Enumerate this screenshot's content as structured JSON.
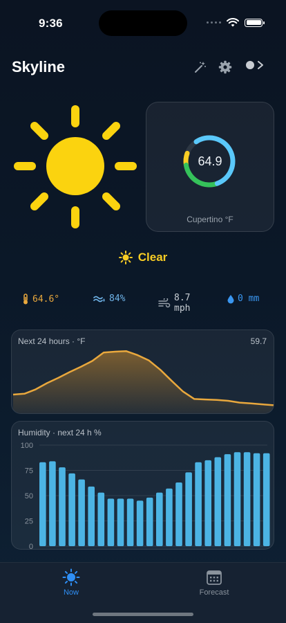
{
  "status_bar": {
    "time": "9:36"
  },
  "header": {
    "title": "Skyline"
  },
  "gauge": {
    "value": "64.9",
    "caption": "Cupertino °F",
    "progress": 0.9
  },
  "condition": {
    "label": "Clear"
  },
  "stats": {
    "temperature": "64.6°",
    "humidity": "84%",
    "wind_value": "8.7",
    "wind_unit": "mph",
    "precipitation": "0 mm"
  },
  "colors": {
    "accent_yellow": "#f9cd24",
    "temp_orange": "#e9a83d",
    "humidity_blue": "#4cb4e4",
    "tab_active": "#2f8ff5"
  },
  "chart_data": [
    {
      "type": "area",
      "title": "Next 24 hours · °F",
      "current_label": "59.7",
      "x": [
        0,
        1,
        2,
        3,
        4,
        5,
        6,
        7,
        8,
        9,
        10,
        11,
        12,
        13,
        14,
        15,
        16,
        17,
        18,
        19,
        20,
        21,
        22,
        23
      ],
      "values": [
        59.9,
        60.1,
        61.1,
        62.5,
        63.7,
        65.0,
        66.2,
        67.5,
        69.4,
        69.6,
        69.7,
        68.8,
        67.6,
        65.5,
        63.0,
        60.6,
        58.9,
        58.8,
        58.7,
        58.5,
        58.1,
        57.9,
        57.7,
        57.5
      ],
      "ylim": [
        56,
        71
      ]
    },
    {
      "type": "bar",
      "title": "Humidity · next 24 h %",
      "yticks": [
        "100",
        "75",
        "50",
        "25",
        "0"
      ],
      "ylim": [
        0,
        100
      ],
      "values": [
        83,
        84,
        78,
        72,
        66,
        59,
        53,
        47,
        47,
        47,
        45,
        48,
        53,
        57,
        63,
        73,
        83,
        85,
        88,
        91,
        93,
        93,
        92,
        92
      ],
      "grid": true
    }
  ],
  "tabs": [
    {
      "label": "Now",
      "active": true
    },
    {
      "label": "Forecast",
      "active": false
    }
  ]
}
